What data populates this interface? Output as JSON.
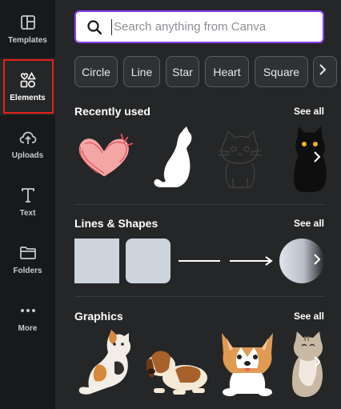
{
  "rail": {
    "items": [
      {
        "label": "Templates",
        "icon": "templates-icon"
      },
      {
        "label": "Elements",
        "icon": "elements-icon"
      },
      {
        "label": "Uploads",
        "icon": "uploads-icon"
      },
      {
        "label": "Text",
        "icon": "text-icon"
      },
      {
        "label": "Folders",
        "icon": "folder-icon"
      },
      {
        "label": "More",
        "icon": "more-icon"
      }
    ],
    "active": "Elements"
  },
  "search": {
    "placeholder": "Search anything from Canva"
  },
  "chips": [
    "Circle",
    "Line",
    "Star",
    "Heart",
    "Square"
  ],
  "sections": {
    "recent": {
      "title": "Recently used",
      "see_all": "See all"
    },
    "lines_shapes": {
      "title": "Lines & Shapes",
      "see_all": "See all"
    },
    "graphics": {
      "title": "Graphics",
      "see_all": "See all"
    }
  },
  "colors": {
    "accent": "#8b3dff",
    "highlight": "#e5201b",
    "rail_bg": "#18191b",
    "panel_bg": "#252627"
  }
}
